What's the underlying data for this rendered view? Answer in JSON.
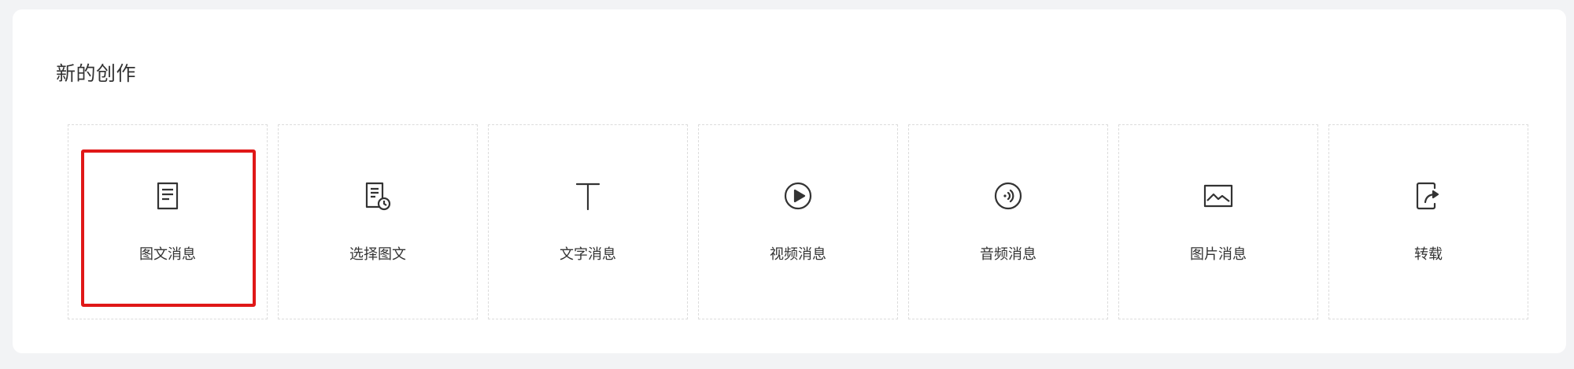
{
  "section": {
    "title": "新的创作"
  },
  "cards": [
    {
      "label": "图文消息",
      "icon": "article-icon",
      "selected": true
    },
    {
      "label": "选择图文",
      "icon": "select-article-icon",
      "selected": false
    },
    {
      "label": "文字消息",
      "icon": "text-icon",
      "selected": false
    },
    {
      "label": "视频消息",
      "icon": "video-icon",
      "selected": false
    },
    {
      "label": "音频消息",
      "icon": "audio-icon",
      "selected": false
    },
    {
      "label": "图片消息",
      "icon": "image-icon",
      "selected": false
    },
    {
      "label": "转载",
      "icon": "repost-icon",
      "selected": false
    }
  ],
  "colors": {
    "highlight": "#e01818",
    "text": "#333333",
    "border": "#dcdcdc",
    "background": "#f2f3f5"
  }
}
